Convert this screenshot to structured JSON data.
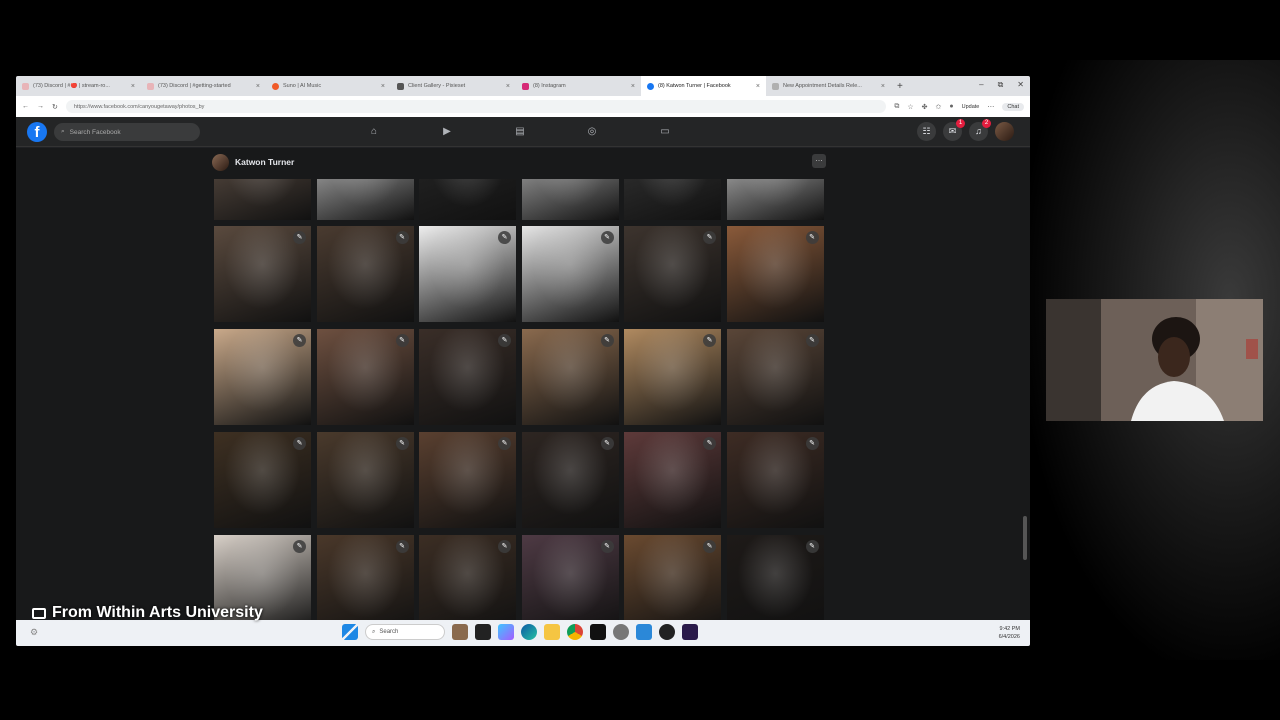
{
  "browser": {
    "tabs": [
      {
        "label": "(73) Discord | #🔴 | stream-ro...",
        "color": "#e8b4b8"
      },
      {
        "label": "(73) Discord | #getting-started",
        "color": "#e8b4b8"
      },
      {
        "label": "Suno | AI Music",
        "color": "#f05a28"
      },
      {
        "label": "Client Gallery - Pixieset",
        "color": "#555555"
      },
      {
        "label": "(8) Instagram",
        "color": "#d62976"
      },
      {
        "label": "(8) Katwon Turner | Facebook",
        "color": "#1877f2",
        "active": true
      },
      {
        "label": "New Appointment Details Rele...",
        "color": "#b0b0b0"
      }
    ],
    "new_tab": "+",
    "window_controls": [
      "–",
      "⧉",
      "✕"
    ],
    "url": "https://www.facebook.com/canyougetaway/photos_by",
    "update_label": "Update",
    "chat_label": "Chat"
  },
  "facebook": {
    "logo": "f",
    "search_placeholder": "Search Facebook",
    "nav_icons": [
      "home-icon",
      "video-icon",
      "marketplace-icon",
      "groups-icon",
      "gaming-icon"
    ],
    "menu_icon": "☷",
    "messenger_icon": "✉",
    "notifications_icon": "♫",
    "messenger_badge": "1",
    "notifications_badge": "2",
    "profile_name": "Katwon Turner",
    "more_label": "…",
    "compose_icon": "✎"
  },
  "photos": {
    "rows": [
      [
        "#6b5a4e",
        "#d9d9d9",
        "#2a2a2a",
        "#cfcfcf",
        "#3a3a3a",
        "#e0e0e0"
      ],
      [
        "#5a4a3e",
        "#4a3b30",
        "#eeeeee",
        "#e6e6e6",
        "#3d342e",
        "#8a5a3a"
      ],
      [
        "#c9a98a",
        "#6e5040",
        "#3a2e28",
        "#8a6a4e",
        "#b08a60",
        "#5a4638"
      ],
      [
        "#3e3022",
        "#4a3a2c",
        "#5a4030",
        "#2e2622",
        "#5e3a3a",
        "#3e2c24"
      ],
      [
        "#d8d0c8",
        "#4a382a",
        "#3c2e24",
        "#4e3a44",
        "#6a4a30",
        "#1e1a18"
      ]
    ]
  },
  "taskbar": {
    "search_placeholder": "Search",
    "time": "9:42 PM",
    "date": "6/4/2026"
  },
  "caption": "From Within Arts University"
}
